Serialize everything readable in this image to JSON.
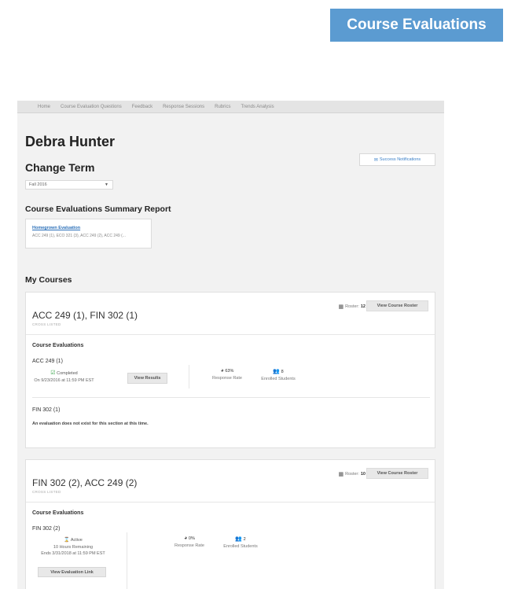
{
  "banner": {
    "title": "Course Evaluations"
  },
  "nav": {
    "items": [
      "Home",
      "Course Evaluation Questions",
      "Feedback",
      "Response Sessions",
      "Rubrics",
      "Trends Analysis"
    ]
  },
  "user": {
    "name": "Debra Hunter"
  },
  "term": {
    "heading": "Change Term",
    "selected": "Fall 2016"
  },
  "success_notifications": {
    "label": "Success Notifications"
  },
  "summary": {
    "heading": "Course Evaluations Summary Report",
    "link": "Homegrown Evaluation",
    "courses": "ACC 249 (1), ECO 321 (3), ACC 249 (2), ACC 249 (..."
  },
  "my_courses": {
    "heading": "My Courses"
  },
  "courses": [
    {
      "title": "ACC 249 (1), FIN 302 (1)",
      "cross_listed": "CROSS LISTED",
      "roster_label": "Roster:",
      "roster_count": "12",
      "roster_button": "View Course Roster",
      "evaluations_heading": "Course Evaluations",
      "sections": [
        {
          "name": "ACC 249 (1)",
          "status": "Completed",
          "date": "On 9/23/2016 at 11:59 PM EST",
          "action": "View Results",
          "response_rate": "63%",
          "response_rate_label": "Response Rate",
          "enrolled": "8",
          "enrolled_label": "Enrolled Students"
        },
        {
          "name": "FIN 302 (1)",
          "message": "An evaluation does not exist for this section at this time."
        }
      ]
    },
    {
      "title": "FIN 302 (2), ACC 249 (2)",
      "cross_listed": "CROSS LISTED",
      "roster_label": "Roster:",
      "roster_count": "10",
      "roster_button": "View Course Roster",
      "evaluations_heading": "Course Evaluations",
      "sections": [
        {
          "name": "FIN 302 (2)",
          "status": "Active",
          "remaining": "10 Hours Remaining",
          "date": "Ends 3/31/2018 at 11:59 PM EST",
          "action": "View Evaluation Link",
          "response_rate": "0%",
          "response_rate_label": "Response Rate",
          "enrolled": "2",
          "enrolled_label": "Enrolled Students"
        }
      ]
    }
  ]
}
